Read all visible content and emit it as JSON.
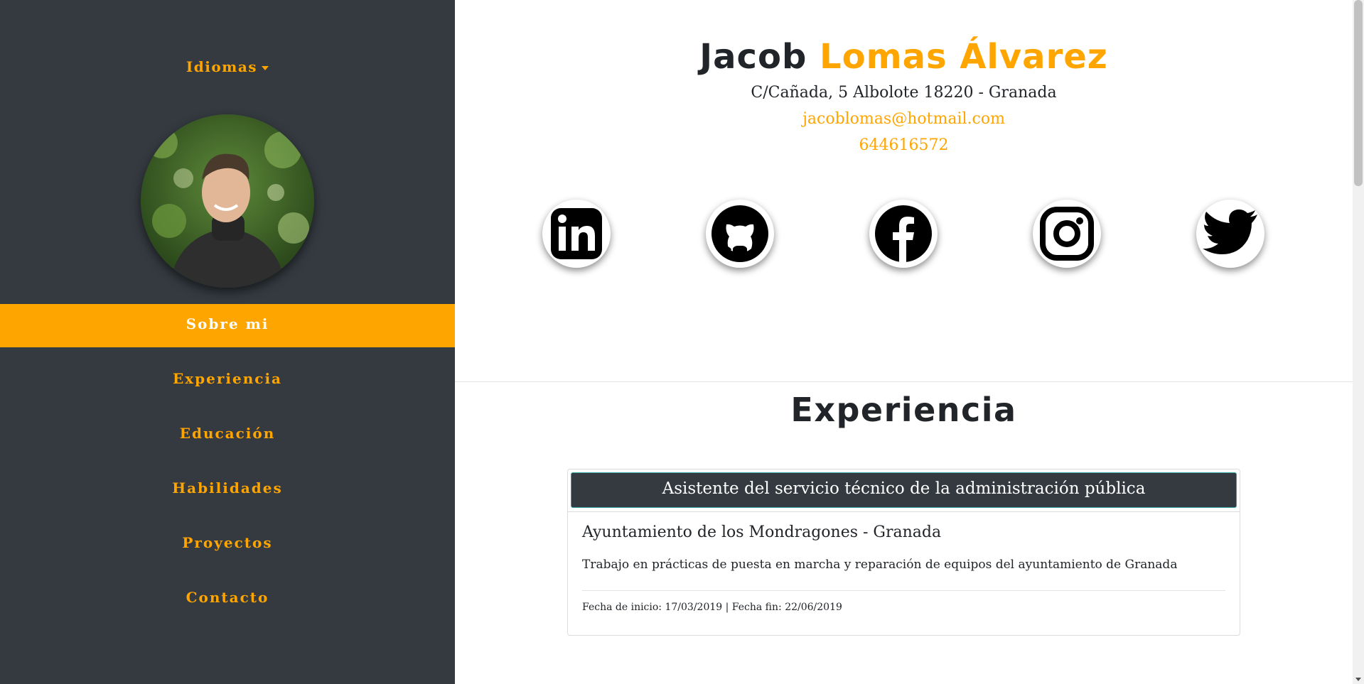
{
  "sidebar": {
    "language_toggle": "Idiomas",
    "nav": [
      {
        "label": "Sobre mi",
        "active": true
      },
      {
        "label": "Experiencia",
        "active": false
      },
      {
        "label": "Educación",
        "active": false
      },
      {
        "label": "Habilidades",
        "active": false
      },
      {
        "label": "Proyectos",
        "active": false
      },
      {
        "label": "Contacto",
        "active": false
      }
    ]
  },
  "profile": {
    "first_name": "Jacob",
    "last_name": "Lomas Álvarez",
    "address": "C/Cañada, 5 Albolote 18220 - Granada",
    "email": "jacoblomas@hotmail.com",
    "phone": "644616572"
  },
  "social_icons": [
    "linkedin-icon",
    "github-icon",
    "facebook-icon",
    "instagram-icon",
    "twitter-icon"
  ],
  "experience": {
    "title": "Experiencia",
    "items": [
      {
        "position": "Asistente del servicio técnico de la administración pública",
        "company": "Ayuntamiento de los Mondragones - Granada",
        "description": "Trabajo en prácticas de puesta en marcha y reparación de equipos del ayuntamiento de Granada",
        "dates": "Fecha de inicio: 17/03/2019 | Fecha fin: 22/06/2019"
      }
    ]
  },
  "colors": {
    "accent": "#ffa500",
    "sidebar_bg": "#343a40",
    "text": "#212529"
  }
}
